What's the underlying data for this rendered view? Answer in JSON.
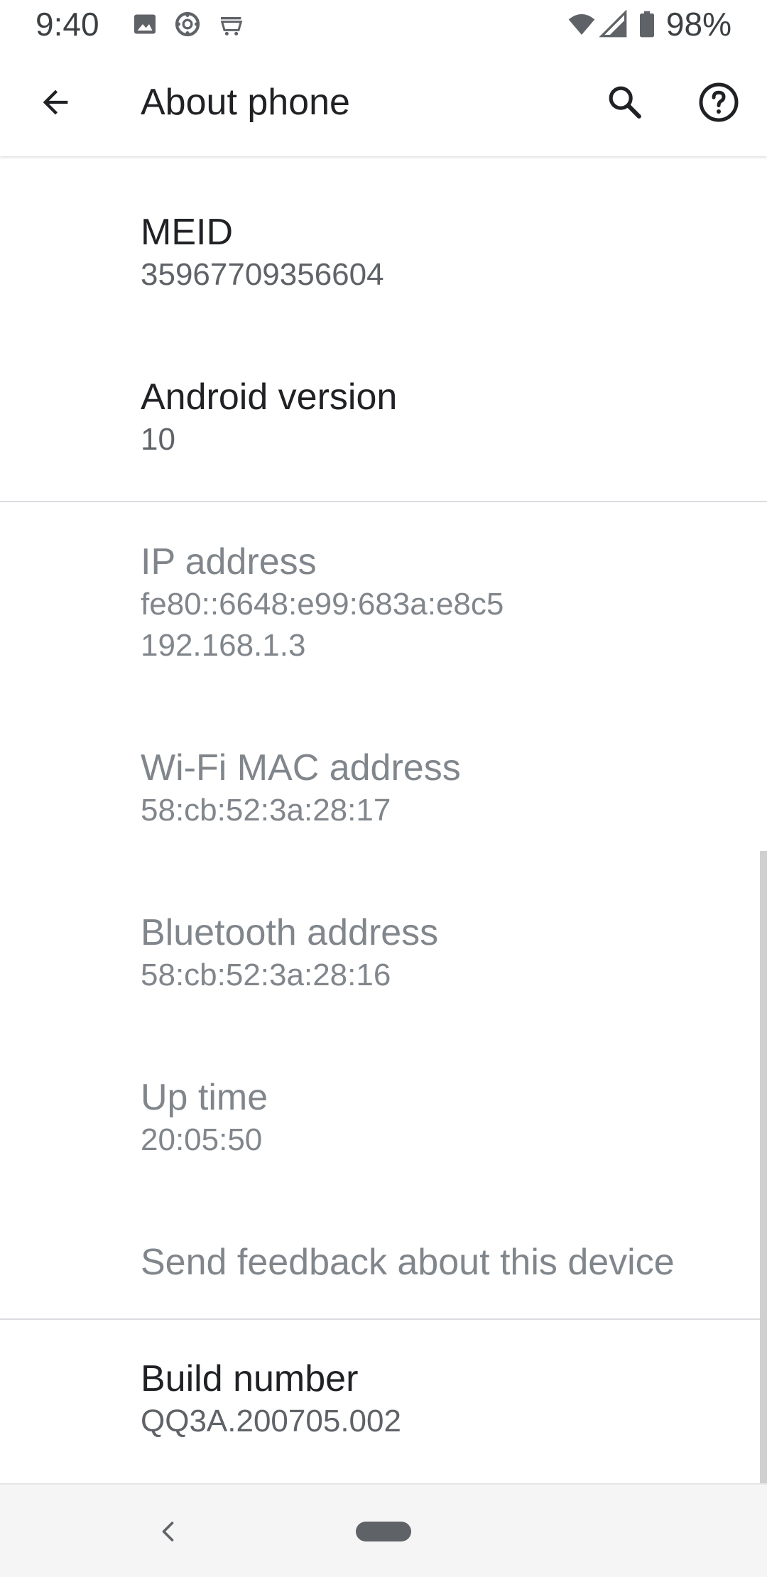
{
  "status_bar": {
    "time": "9:40",
    "notification_icons": [
      "image-icon",
      "ring-icon",
      "amazon-cart-icon"
    ],
    "battery_text": "98%",
    "system_icons": [
      "wifi-icon",
      "cell-signal-icon",
      "battery-icon"
    ]
  },
  "app_bar": {
    "title": "About phone",
    "back_icon": "arrow-back-icon",
    "search_icon": "search-icon",
    "help_icon": "help-icon"
  },
  "items": [
    {
      "title": "MEID",
      "summary": "35967709356604"
    },
    {
      "title": "Android version",
      "summary": "10"
    },
    {
      "title": "IP address",
      "summary_lines": [
        "fe80::6648:e99:683a:e8c5",
        "192.168.1.3"
      ]
    },
    {
      "title": "Wi-Fi MAC address",
      "summary": "58:cb:52:3a:28:17"
    },
    {
      "title": "Bluetooth address",
      "summary": "58:cb:52:3a:28:16"
    },
    {
      "title": "Up time",
      "summary": "20:05:50"
    },
    {
      "title": "Send feedback about this device"
    },
    {
      "title": "Build number",
      "summary": "QQ3A.200705.002"
    }
  ],
  "nav_bar": {
    "back_icon": "nav-back-icon",
    "home_icon": "home-pill-icon"
  },
  "colors": {
    "primary_text": "#202124",
    "secondary_text": "#5f6368",
    "disabled_text": "#80868b",
    "divider": "#dadce0"
  }
}
